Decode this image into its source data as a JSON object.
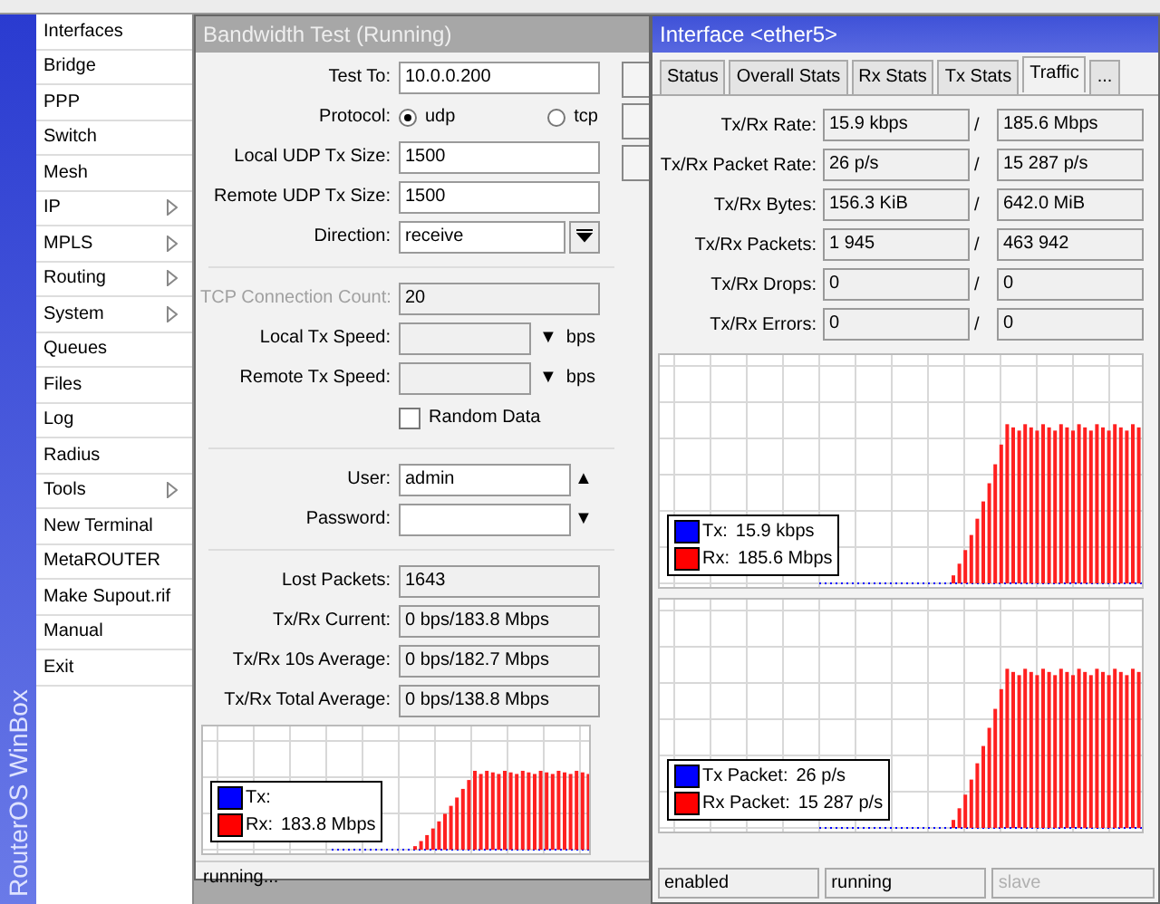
{
  "sidebar": {
    "brand": "RouterOS WinBox",
    "items": [
      {
        "label": "Interfaces",
        "submenu": false
      },
      {
        "label": "Bridge",
        "submenu": false
      },
      {
        "label": "PPP",
        "submenu": false
      },
      {
        "label": "Switch",
        "submenu": false
      },
      {
        "label": "Mesh",
        "submenu": false
      },
      {
        "label": "IP",
        "submenu": true
      },
      {
        "label": "MPLS",
        "submenu": true
      },
      {
        "label": "Routing",
        "submenu": true
      },
      {
        "label": "System",
        "submenu": true
      },
      {
        "label": "Queues",
        "submenu": false
      },
      {
        "label": "Files",
        "submenu": false
      },
      {
        "label": "Log",
        "submenu": false
      },
      {
        "label": "Radius",
        "submenu": false
      },
      {
        "label": "Tools",
        "submenu": true
      },
      {
        "label": "New Terminal",
        "submenu": false
      },
      {
        "label": "MetaROUTER",
        "submenu": false
      },
      {
        "label": "Make Supout.rif",
        "submenu": false
      },
      {
        "label": "Manual",
        "submenu": false
      },
      {
        "label": "Exit",
        "submenu": false
      }
    ]
  },
  "bandwidth_test": {
    "title": "Bandwidth Test (Running)",
    "active": false,
    "fields": [
      {
        "kind": "text",
        "label": "Test To:",
        "value": "10.0.0.200"
      },
      {
        "kind": "radio",
        "label": "Protocol:",
        "options": [
          {
            "label": "udp",
            "selected": true
          },
          {
            "label": "tcp",
            "selected": false
          }
        ]
      },
      {
        "kind": "text",
        "label": "Local UDP Tx Size:",
        "value": "1500"
      },
      {
        "kind": "text",
        "label": "Remote UDP Tx Size:",
        "value": "1500"
      },
      {
        "kind": "select",
        "label": "Direction:",
        "value": "receive"
      },
      {
        "kind": "separator"
      },
      {
        "kind": "text",
        "label": "TCP Connection Count:",
        "value": "20",
        "disabled": true
      },
      {
        "kind": "speed",
        "label": "Local Tx Speed:",
        "arrow": "▼",
        "unit": "bps"
      },
      {
        "kind": "speed",
        "label": "Remote Tx Speed:",
        "arrow": "▼",
        "unit": "bps"
      },
      {
        "kind": "checkbox",
        "label": "Random Data",
        "checked": false
      },
      {
        "kind": "separator"
      },
      {
        "kind": "combo",
        "label": "User:",
        "value": "admin",
        "arrow": "▲"
      },
      {
        "kind": "combo",
        "label": "Password:",
        "arrow": "▼"
      },
      {
        "kind": "separator"
      },
      {
        "kind": "readonly",
        "label": "Lost Packets:",
        "value": "1643"
      },
      {
        "kind": "readonly",
        "label": "Tx/Rx Current:",
        "value": "0 bps/183.8 Mbps"
      },
      {
        "kind": "readonly",
        "label": "Tx/Rx 10s Average:",
        "value": "0 bps/182.7 Mbps"
      },
      {
        "kind": "readonly",
        "label": "Tx/Rx Total Average:",
        "value": "0 bps/138.8 Mbps"
      }
    ],
    "chart": {
      "legend": [
        {
          "label": "Tx:",
          "color": "#0000ff"
        },
        {
          "label": "Rx:",
          "reading": "183.8 Mbps",
          "color": "#ff0000"
        }
      ]
    },
    "status": "running..."
  },
  "interface": {
    "title": "Interface <ether5>",
    "active": true,
    "tabs": [
      {
        "label": "Status",
        "selected": false
      },
      {
        "label": "Overall Stats",
        "selected": false
      },
      {
        "label": "Rx Stats",
        "selected": false
      },
      {
        "label": "Tx Stats",
        "selected": false
      },
      {
        "label": "Traffic",
        "selected": true
      },
      {
        "label": "...",
        "selected": false
      }
    ],
    "rows": [
      {
        "label": "Tx/Rx Rate:",
        "tx": "15.9 kbps",
        "slash": "/",
        "rx": "185.6 Mbps"
      },
      {
        "label": "Tx/Rx Packet Rate:",
        "tx": "26 p/s",
        "slash": "/",
        "rx": "15 287 p/s"
      },
      {
        "label": "Tx/Rx Bytes:",
        "tx": "156.3 KiB",
        "slash": "/",
        "rx": "642.0 MiB"
      },
      {
        "label": "Tx/Rx Packets:",
        "tx": "1 945",
        "slash": "/",
        "rx": "463 942"
      },
      {
        "label": "Tx/Rx Drops:",
        "tx": "0",
        "slash": "/",
        "rx": "0"
      },
      {
        "label": "Tx/Rx Errors:",
        "tx": "0",
        "slash": "/",
        "rx": "0"
      }
    ],
    "charts": [
      {
        "legend": [
          {
            "label": "Tx:",
            "reading": "15.9 kbps",
            "color": "#0000ff"
          },
          {
            "label": "Rx:",
            "reading": "185.6 Mbps",
            "color": "#ff0000"
          }
        ]
      },
      {
        "legend": [
          {
            "label": "Tx Packet:",
            "reading": "26 p/s",
            "color": "#0000ff"
          },
          {
            "label": "Rx Packet:",
            "reading": "15 287 p/s",
            "color": "#ff0000"
          }
        ]
      }
    ],
    "status": [
      {
        "text": "enabled",
        "disabled": false
      },
      {
        "text": "running",
        "disabled": false
      },
      {
        "text": "slave",
        "disabled": true
      }
    ]
  }
}
